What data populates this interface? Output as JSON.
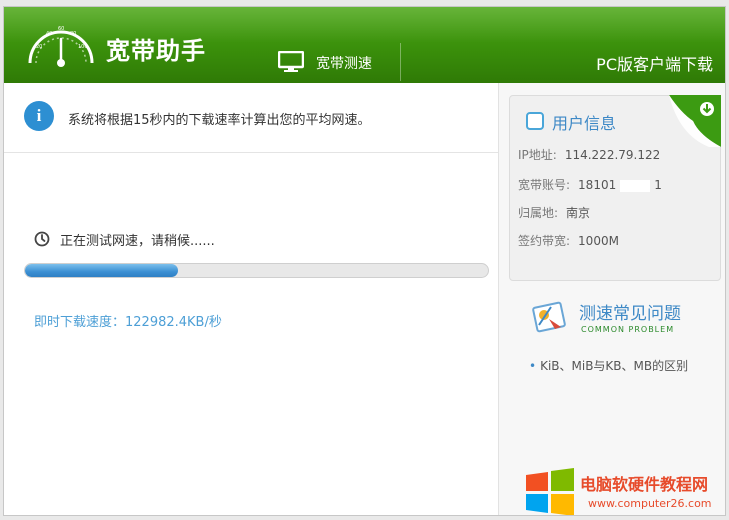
{
  "header": {
    "app_title": "宽带助手",
    "tab_label": "宽带测速",
    "pc_link": "PC版客户端下载"
  },
  "notice": {
    "icon": "info-icon",
    "text": "系统将根据15秒内的下载速率计算出您的平均网速。"
  },
  "test": {
    "status_text": "正在测试网速，请稍候......",
    "progress": 0.33,
    "speed_text": "即时下载速度：122982.4KB/秒"
  },
  "user_info": {
    "title": "用户信息",
    "rows": [
      {
        "label": "IP地址:",
        "value": "114.222.79.122"
      },
      {
        "label": "宽带账号:",
        "value_prefix": "18101",
        "value_suffix": "1"
      },
      {
        "label": "归属地:",
        "value": "南京"
      },
      {
        "label": "签约带宽:",
        "value": "1000M"
      }
    ]
  },
  "faq": {
    "title": "测速常见问题",
    "subtitle": "COMMON PROBLEM",
    "items": [
      "KiB、MiB与KB、MB的区别"
    ]
  },
  "watermark": {
    "title": "电脑软硬件教程网",
    "url": "www.computer26.com"
  },
  "colors": {
    "header_green": "#3a8f0b",
    "accent_blue": "#3e89c6",
    "progress_blue": "#3b8fd3"
  }
}
